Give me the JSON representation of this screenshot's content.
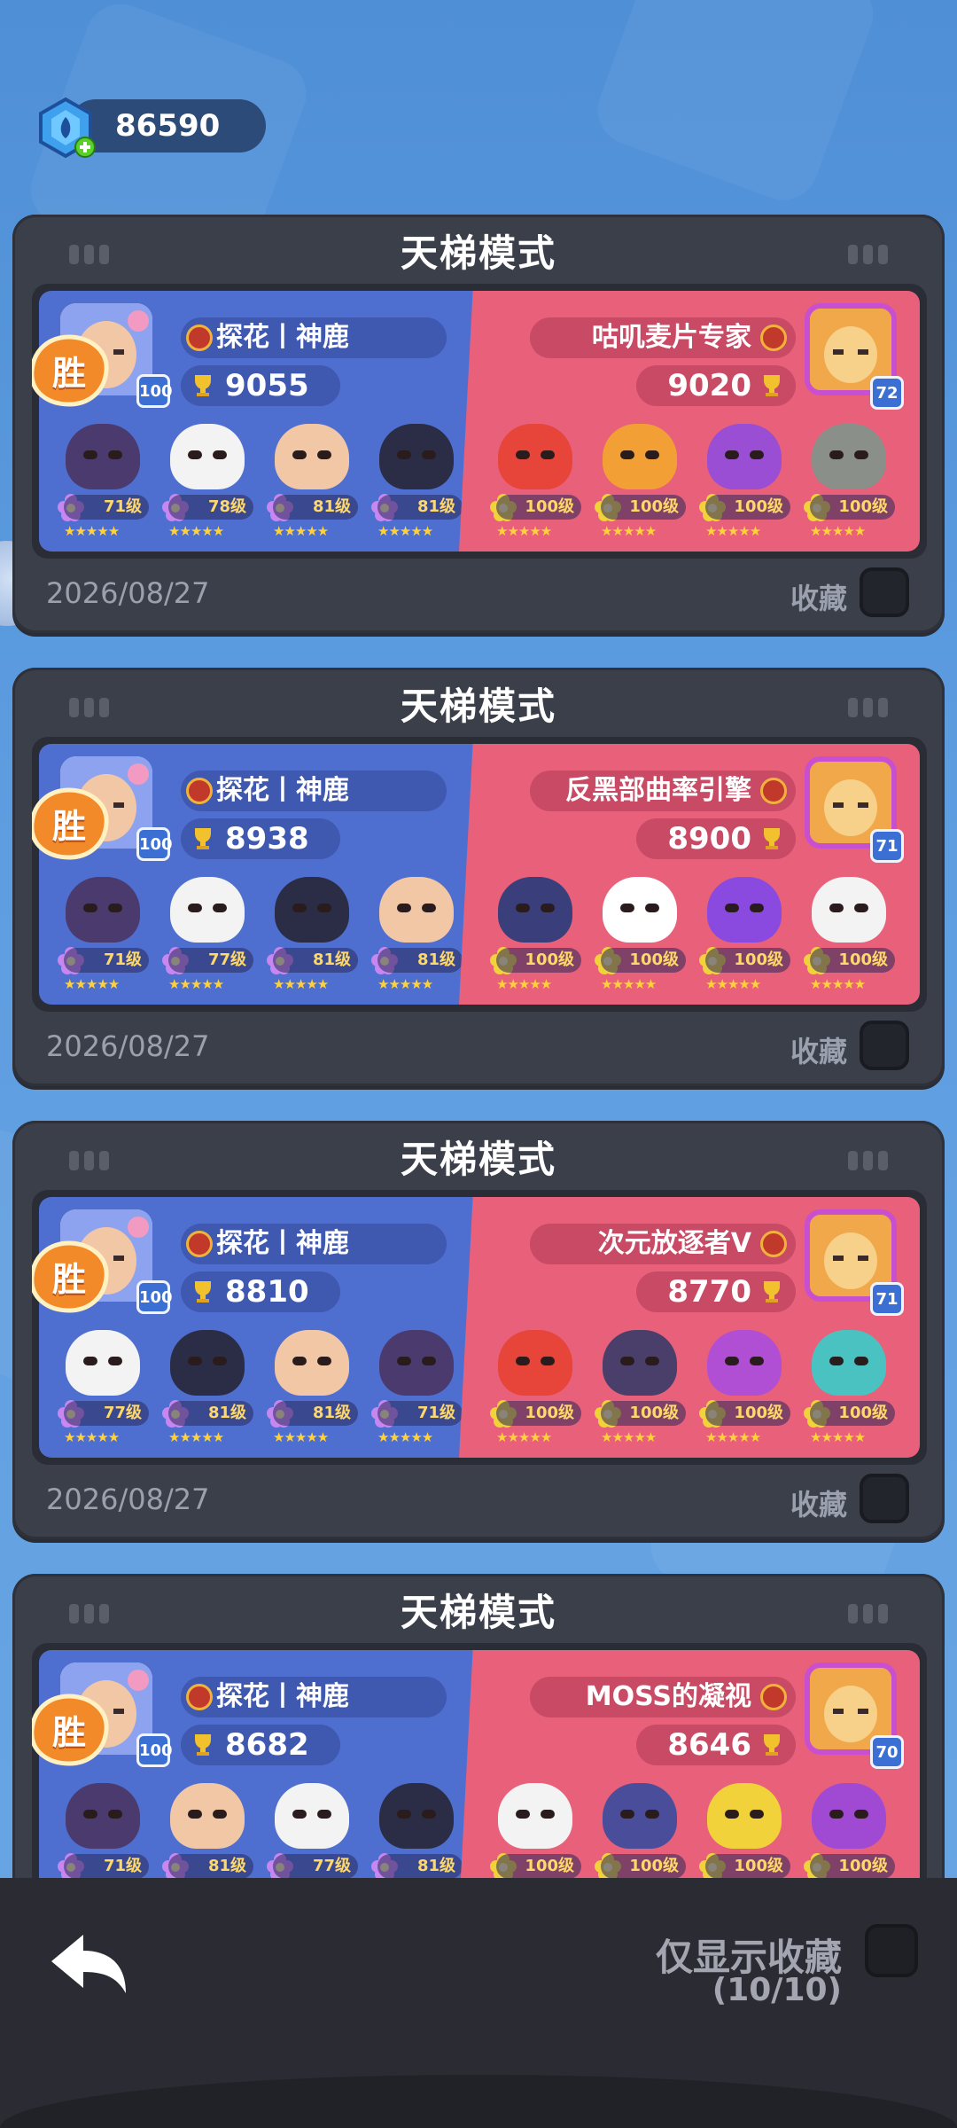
{
  "currency": {
    "value": "86590",
    "icon": "blue-gem-icon"
  },
  "matches": [
    {
      "mode": "天梯模式",
      "result": "胜",
      "date": "2026/08/27",
      "fav_label": "收藏",
      "left": {
        "name": "探花丨神鹿",
        "trophies": "9055",
        "level": "100",
        "heroes": [
          {
            "lvl": "71级",
            "color": "#4a3a6e"
          },
          {
            "lvl": "78级",
            "color": "#f3f3f3"
          },
          {
            "lvl": "81级",
            "color": "#f2c7a6"
          },
          {
            "lvl": "81级",
            "color": "#2a2d45"
          }
        ]
      },
      "right": {
        "name": "咕叽麦片专家",
        "trophies": "9020",
        "level": "72",
        "heroes": [
          {
            "lvl": "100级",
            "color": "#e8453a"
          },
          {
            "lvl": "100级",
            "color": "#f2a035"
          },
          {
            "lvl": "100级",
            "color": "#9a4ed4"
          },
          {
            "lvl": "100级",
            "color": "#8a8f8a"
          }
        ]
      }
    },
    {
      "mode": "天梯模式",
      "result": "胜",
      "date": "2026/08/27",
      "fav_label": "收藏",
      "left": {
        "name": "探花丨神鹿",
        "trophies": "8938",
        "level": "100",
        "heroes": [
          {
            "lvl": "71级",
            "color": "#4a3a6e"
          },
          {
            "lvl": "77级",
            "color": "#f3f3f3"
          },
          {
            "lvl": "81级",
            "color": "#2a2d45"
          },
          {
            "lvl": "81级",
            "color": "#f2c7a6"
          }
        ]
      },
      "right": {
        "name": "反黑部曲率引擎",
        "trophies": "8900",
        "level": "71",
        "heroes": [
          {
            "lvl": "100级",
            "color": "#3a3e7a"
          },
          {
            "lvl": "100级",
            "color": "#ffffff"
          },
          {
            "lvl": "100级",
            "color": "#8a4ae0"
          },
          {
            "lvl": "100级",
            "color": "#f3f3f3"
          }
        ]
      }
    },
    {
      "mode": "天梯模式",
      "result": "胜",
      "date": "2026/08/27",
      "fav_label": "收藏",
      "left": {
        "name": "探花丨神鹿",
        "trophies": "8810",
        "level": "100",
        "heroes": [
          {
            "lvl": "77级",
            "color": "#f3f3f3"
          },
          {
            "lvl": "81级",
            "color": "#2a2d45"
          },
          {
            "lvl": "81级",
            "color": "#f2c7a6"
          },
          {
            "lvl": "71级",
            "color": "#4a3a6e"
          }
        ]
      },
      "right": {
        "name": "次元放逐者V",
        "trophies": "8770",
        "level": "71",
        "heroes": [
          {
            "lvl": "100级",
            "color": "#e8453a"
          },
          {
            "lvl": "100级",
            "color": "#4a3e6a"
          },
          {
            "lvl": "100级",
            "color": "#b04ed4"
          },
          {
            "lvl": "100级",
            "color": "#4ac2c2"
          }
        ]
      }
    },
    {
      "mode": "天梯模式",
      "result": "胜",
      "date": "",
      "fav_label": "",
      "left": {
        "name": "探花丨神鹿",
        "trophies": "8682",
        "level": "100",
        "heroes": [
          {
            "lvl": "71级",
            "color": "#4a3a6e"
          },
          {
            "lvl": "81级",
            "color": "#f2c7a6"
          },
          {
            "lvl": "77级",
            "color": "#f3f3f3"
          },
          {
            "lvl": "81级",
            "color": "#2a2d45"
          }
        ]
      },
      "right": {
        "name": "MOSS的凝视",
        "trophies": "8646",
        "level": "70",
        "heroes": [
          {
            "lvl": "100级",
            "color": "#f3f3f3"
          },
          {
            "lvl": "100级",
            "color": "#4a4e9a"
          },
          {
            "lvl": "100级",
            "color": "#f2d23a"
          },
          {
            "lvl": "100级",
            "color": "#a04ad4"
          }
        ]
      }
    }
  ],
  "bottom": {
    "filter_label": "仅显示收藏",
    "count": "(10/10)"
  }
}
